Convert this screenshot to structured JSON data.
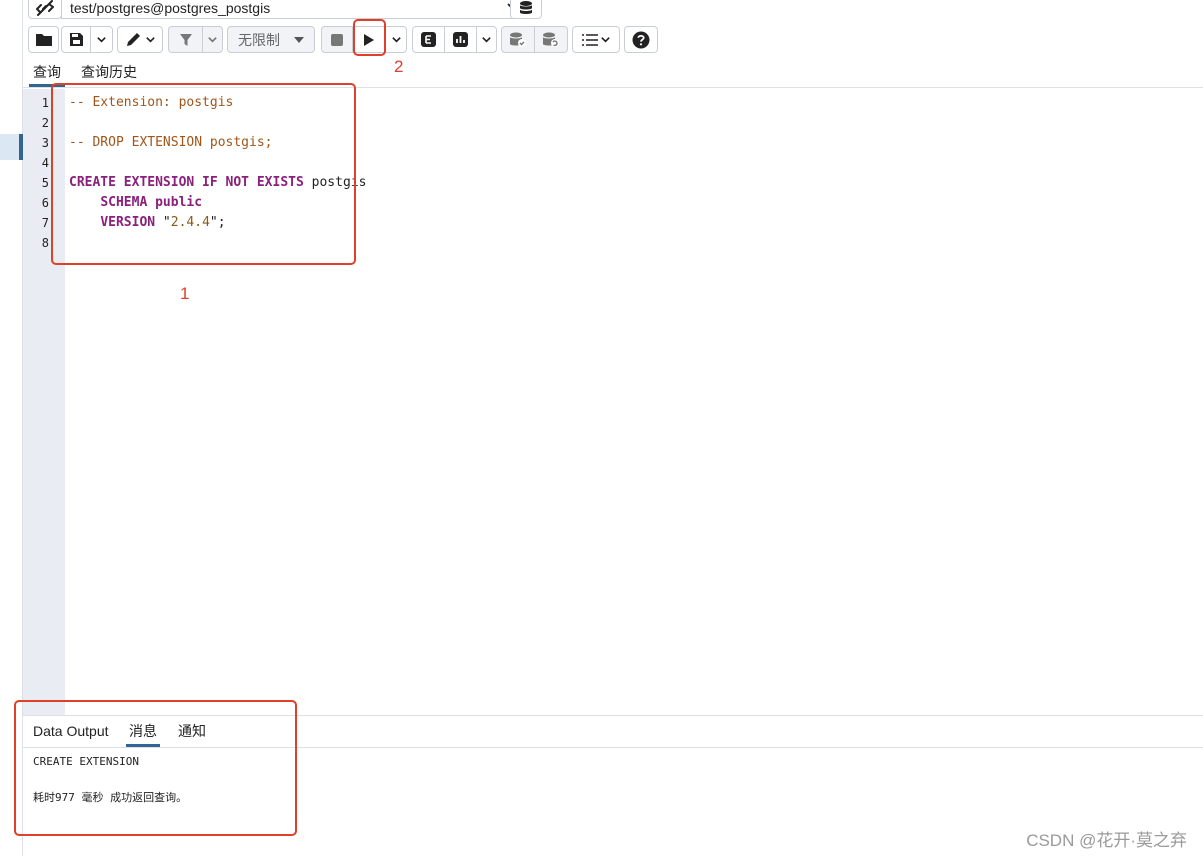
{
  "connection": {
    "label": "test/postgres@postgres_postgis"
  },
  "toolbar": {
    "row_limit": "无限制"
  },
  "query_tabs": [
    {
      "label": "查询",
      "active": true
    },
    {
      "label": "查询历史",
      "active": false
    }
  ],
  "editor": {
    "line_numbers": [
      "1",
      "2",
      "3",
      "4",
      "5",
      "6",
      "7",
      "8"
    ],
    "lines": {
      "l1": "-- Extension: postgis",
      "l3": "-- DROP EXTENSION postgis;",
      "l5_kw": "CREATE EXTENSION IF NOT EXISTS",
      "l5_name": " postgis",
      "l6_kw": "SCHEMA public",
      "l7_kw": "VERSION",
      "l7_q1": " \"",
      "l7_num": "2.4.4",
      "l7_q2": "\";"
    }
  },
  "output_tabs": [
    {
      "label": "Data Output",
      "active": false
    },
    {
      "label": "消息",
      "active": true
    },
    {
      "label": "通知",
      "active": false
    }
  ],
  "messages": {
    "line1": "CREATE EXTENSION",
    "line2": "耗时977 毫秒 成功返回查询。"
  },
  "annotations": {
    "n1": "1",
    "n2": "2"
  },
  "watermark": "CSDN @花开·莫之弃",
  "colors": {
    "annotation": "#e0402a",
    "active_tab": "#326690",
    "keyword": "#8a1f7c",
    "comment": "#a0561a"
  },
  "icons": [
    "link-icon",
    "chevron-down-icon",
    "database-icon",
    "folder-icon",
    "save-icon",
    "pencil-icon",
    "filter-icon",
    "caret-down-icon",
    "stop-icon",
    "play-icon",
    "explain-icon",
    "chart-icon",
    "commit-icon",
    "rollback-icon",
    "list-icon",
    "help-icon"
  ]
}
